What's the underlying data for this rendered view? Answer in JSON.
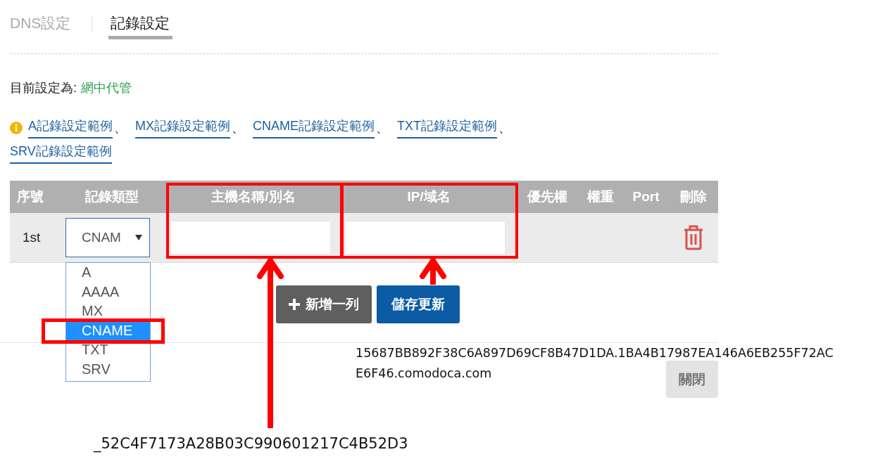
{
  "tabs": [
    {
      "label": "DNS設定",
      "selected": false
    },
    {
      "label": "記錄設定",
      "selected": true
    }
  ],
  "current_setting": {
    "label": "目前設定為:",
    "value": "網中代管"
  },
  "example_links": [
    {
      "label": "A記錄設定範例",
      "separator": "、"
    },
    {
      "label": "MX記錄設定範例",
      "separator": "、"
    },
    {
      "label": "CNAME記錄設定範例",
      "separator": "、"
    },
    {
      "label": "TXT記錄設定範例",
      "separator": "、"
    },
    {
      "label": "SRV記錄設定範例"
    }
  ],
  "table": {
    "columns": [
      "序號",
      "記錄類型",
      "主機名稱/別名",
      "IP/域名",
      "優先權",
      "權重",
      "Port",
      "刪除"
    ],
    "rows": [
      {
        "index": "1st",
        "record_type": "CNAM"
      }
    ]
  },
  "record_type_options": [
    {
      "label": "A",
      "selected": false
    },
    {
      "label": "AAAA",
      "selected": false
    },
    {
      "label": "MX",
      "selected": false
    },
    {
      "label": "CNAME",
      "selected": true
    },
    {
      "label": "TXT",
      "selected": false
    },
    {
      "label": "SRV",
      "selected": false
    }
  ],
  "buttons": [
    {
      "label": "新增一列",
      "kind": "add"
    },
    {
      "label": "儲存更新",
      "kind": "save"
    }
  ],
  "close_button": "關閉",
  "annotations": {
    "ip_value_lines": [
      "15687BB892F38C6A897D69CF8B47D1DA.1BA4B17987EA146A6EB255F72AC",
      "E6F46.comodoca.com"
    ],
    "host_value": "_52C4F7173A28B03C990601217C4B52D3"
  }
}
